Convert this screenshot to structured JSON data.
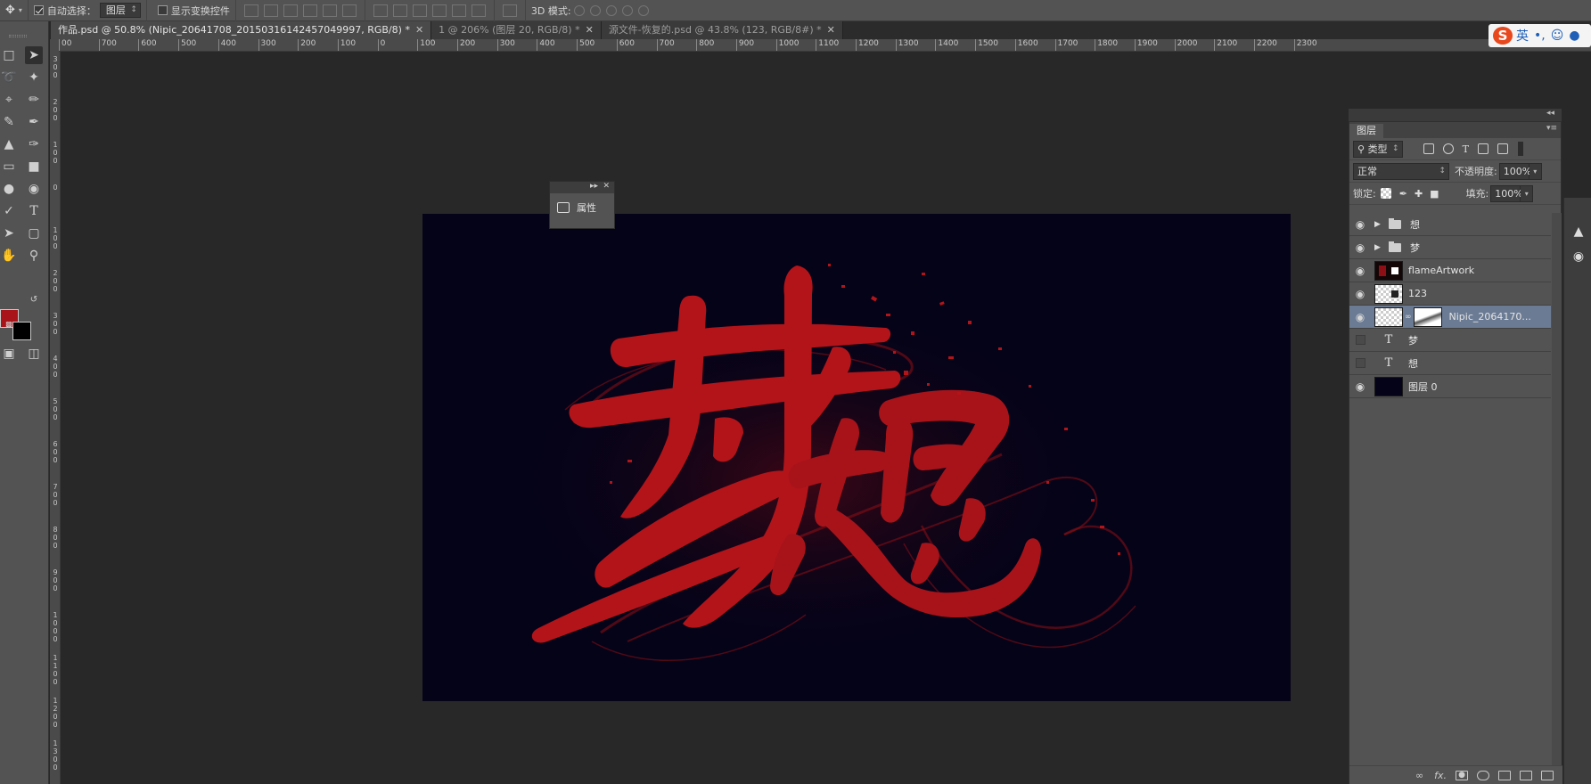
{
  "options_bar": {
    "move_icon": "move-tool-icon",
    "auto_select_label": "自动选择：",
    "auto_select_checked": true,
    "auto_select_value": "图层",
    "show_transform_label": "显示变换控件",
    "show_transform_checked": false,
    "mode_3d_label": "3D 模式:"
  },
  "tabs": [
    {
      "label": "作品.psd @ 50.8% (Nipic_20641708_20150316142457049997, RGB/8) *",
      "active": true
    },
    {
      "label": "1 @ 206% (图层 20, RGB/8) *",
      "active": false
    },
    {
      "label": "源文件-恢复的.psd @ 43.8% (123, RGB/8#) *",
      "active": false
    }
  ],
  "ruler": {
    "h_ticks": [
      "00",
      "700",
      "600",
      "500",
      "400",
      "300",
      "200",
      "100",
      "0",
      "100",
      "200",
      "300",
      "400",
      "500",
      "600",
      "700",
      "800",
      "900",
      "1000",
      "1100",
      "1200",
      "1300",
      "1400",
      "1500",
      "1600",
      "1700",
      "1800",
      "1900",
      "2000",
      "2100",
      "2200",
      "2300"
    ],
    "v_ticks": [
      "3 0 0",
      "2 0 0",
      "1 0 0",
      "0",
      "1 0 0",
      "2 0 0",
      "3 0 0",
      "4 0 0",
      "5 0 0",
      "6 0 0",
      "7 0 0",
      "8 0 0",
      "9 0 0",
      "1 0 0 0",
      "1 1 0 0",
      "1 2 0 0",
      "1 3 0 0"
    ]
  },
  "colors": {
    "foreground": "#a8141a",
    "background": "#000000",
    "canvas_bg": "#050318",
    "accent_red": "#b3141a"
  },
  "properties_panel": {
    "label": "属性",
    "icon": "properties-icon"
  },
  "ime": {
    "logo": "S",
    "lang": "英",
    "punct": "•,",
    "emoji_icon": "smile-icon",
    "mic_icon": "mic-icon"
  },
  "layers_panel": {
    "tab_label": "图层",
    "filter_type": "类型",
    "blend_mode": "正常",
    "opacity_label": "不透明度:",
    "opacity_value": "100%",
    "lock_label": "锁定:",
    "fill_label": "填充:",
    "fill_value": "100%",
    "layers": [
      {
        "name": "想",
        "kind": "group",
        "visible": true,
        "selected": false
      },
      {
        "name": "梦",
        "kind": "group",
        "visible": true,
        "selected": false
      },
      {
        "name": "flameArtwork",
        "kind": "image",
        "visible": true,
        "selected": false
      },
      {
        "name": "123",
        "kind": "image",
        "visible": true,
        "selected": false
      },
      {
        "name": "Nipic_2064170...",
        "kind": "masked",
        "visible": true,
        "selected": true
      },
      {
        "name": "梦",
        "kind": "text",
        "visible": false,
        "selected": false
      },
      {
        "name": "想",
        "kind": "text",
        "visible": false,
        "selected": false
      },
      {
        "name": "图层 0",
        "kind": "fill",
        "visible": true,
        "selected": false
      }
    ],
    "footer_icons": [
      "link-icon",
      "fx-icon",
      "mask-icon",
      "adjustment-icon",
      "folder-icon",
      "new-layer-icon",
      "trash-icon"
    ],
    "fx_label": "fx."
  }
}
